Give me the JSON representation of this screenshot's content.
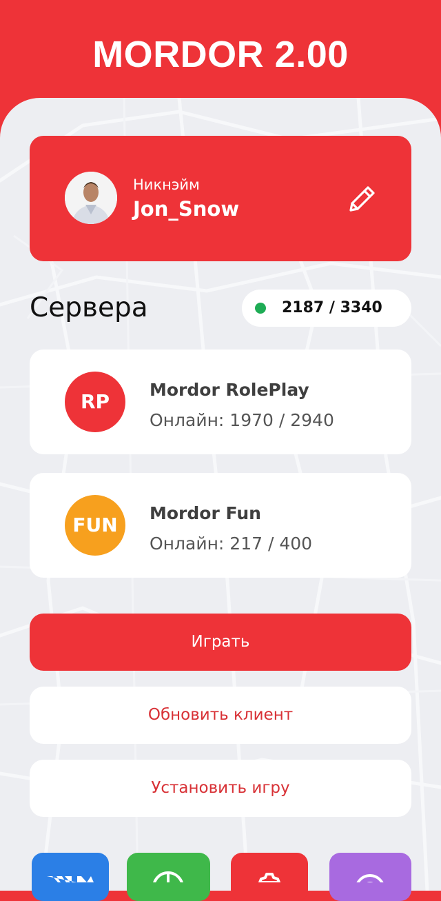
{
  "app": {
    "title": "MORDOR 2.00"
  },
  "profile": {
    "caption": "Никнэйм",
    "nickname": "Jon_Snow",
    "icons": {
      "avatar": "character-avatar",
      "edit": "pencil-icon"
    }
  },
  "servers_section": {
    "title": "Сервера",
    "online_total": "2187 / 3340",
    "online_indicator_color": "#1eac55"
  },
  "servers": [
    {
      "badge": "RP",
      "badge_color": "#ee3338",
      "name": "Mordor RolePlay",
      "online": "Онлайн: 1970 / 2940"
    },
    {
      "badge": "FUN",
      "badge_color": "#f7a01e",
      "name": "Mordor Fun",
      "online": "Онлайн: 217 / 400"
    }
  ],
  "actions": {
    "play": "Играть",
    "update_client": "Обновить клиент",
    "install_game": "Установить игру"
  },
  "social_icons": [
    "vk-icon",
    "donate-icon",
    "settings-icon",
    "support-icon"
  ],
  "colors": {
    "accent": "#ee3338",
    "panel_bg": "#edeef2",
    "fun": "#f7a01e"
  }
}
